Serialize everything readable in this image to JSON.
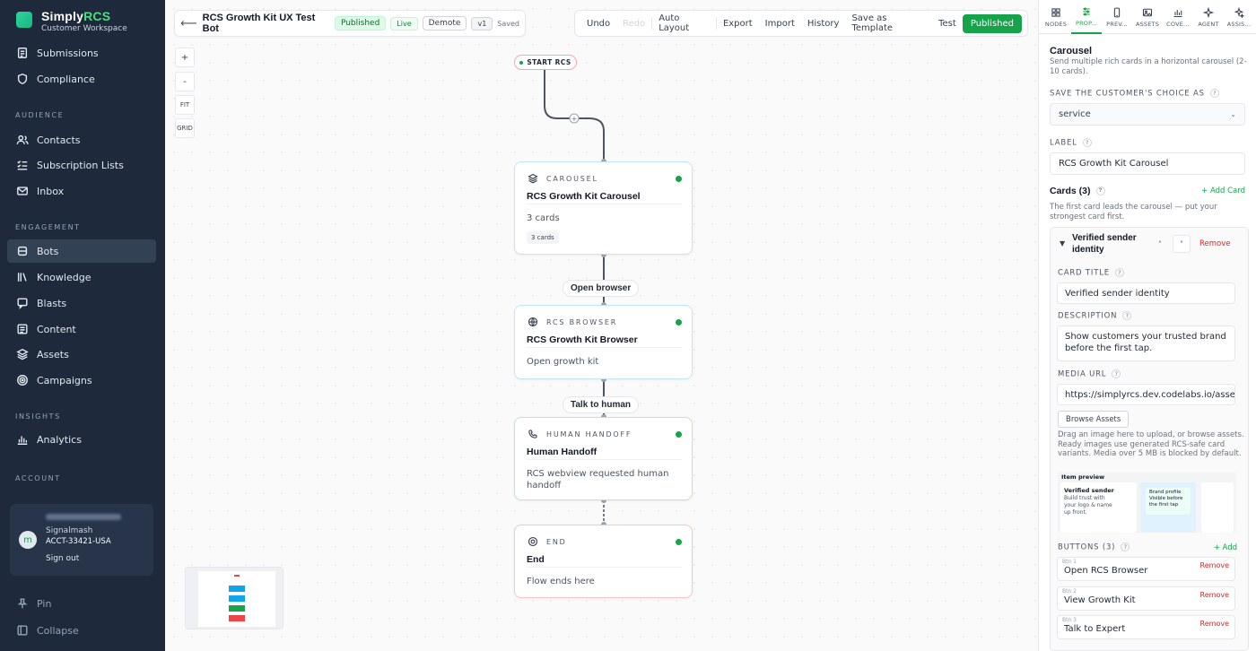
{
  "brand": {
    "name_prefix": "Simply",
    "name_suffix": "RCS",
    "subtitle": "Customer Workspace"
  },
  "sidebar": {
    "sections": {
      "audience": "AUDIENCE",
      "engagement": "ENGAGEMENT",
      "insights": "INSIGHTS",
      "account": "ACCOUNT"
    },
    "items": {
      "submissions": "Submissions",
      "compliance": "Compliance",
      "contacts": "Contacts",
      "subscription_lists": "Subscription Lists",
      "inbox": "Inbox",
      "bots": "Bots",
      "knowledge": "Knowledge",
      "blasts": "Blasts",
      "content": "Content",
      "assets": "Assets",
      "campaigns": "Campaigns",
      "analytics": "Analytics",
      "pin": "Pin",
      "collapse": "Collapse"
    },
    "active": "bots",
    "account": {
      "avatar_letter": "m",
      "org": "Signalmash",
      "id": "ACCT-33421-USA",
      "sign_out": "Sign out"
    }
  },
  "toolbar": {
    "back": "⟵",
    "bot_title": "RCS Growth Kit UX Test Bot",
    "status": "Published",
    "live": "Live",
    "demote": "Demote",
    "version": "v1",
    "saved": "Saved",
    "actions": {
      "undo": "Undo",
      "redo": "Redo",
      "auto_layout": "Auto Layout",
      "export": "Export",
      "import": "Import",
      "history": "History",
      "save_template": "Save as Template",
      "test": "Test",
      "published": "Published"
    }
  },
  "zoom": {
    "in": "+",
    "out": "-",
    "fit": "FIT",
    "grid": "GRID"
  },
  "flow": {
    "start": "START RCS",
    "nodes": [
      {
        "type": "CAROUSEL",
        "title": "RCS Growth Kit Carousel",
        "desc": "3 cards",
        "badge": "3 cards"
      },
      {
        "type": "RCS BROWSER",
        "title": "RCS Growth Kit Browser",
        "desc": "Open growth kit"
      },
      {
        "type": "HUMAN HANDOFF",
        "title": "Human Handoff",
        "desc": "RCS webview requested human handoff"
      },
      {
        "type": "END",
        "title": "End",
        "desc": "Flow ends here"
      }
    ],
    "edges": {
      "open_browser": "Open browser",
      "talk_to_human": "Talk to human",
      "add": "+"
    }
  },
  "panel": {
    "tabs": [
      "NODES",
      "PROP...",
      "PREV...",
      "ASSETS",
      "COVE...",
      "AGENT",
      "ASSIS..."
    ],
    "active_tab": 1,
    "title": "Carousel",
    "subtitle": "Send multiple rich cards in a horizontal carousel (2-10 cards).",
    "save_choice_label": "SAVE THE CUSTOMER'S CHOICE AS",
    "save_choice_value": "service",
    "label_label": "LABEL",
    "label_value": "RCS Growth Kit Carousel",
    "cards_heading": "Cards (3)",
    "add_card": "+ Add Card",
    "cards_note": "The first card leads the carousel — put your strongest card first.",
    "qmark": "?",
    "card": {
      "name": "Verified sender identity",
      "up": "˄",
      "down": "˅",
      "caret": "▼",
      "remove": "Remove",
      "title_label": "CARD TITLE",
      "title_value": "Verified sender identity",
      "desc_label": "DESCRIPTION",
      "desc_value": "Show customers your trusted brand before the first tap.",
      "media_label": "MEDIA URL",
      "media_value": "https://simplyrcs.dev.codelabs.io/assets",
      "browse": "Browse Assets",
      "drag_note": "Drag an image here to upload, or browse assets. Ready images use generated RCS-safe card variants. Media over 5 MB is blocked by default.",
      "preview": {
        "heading": "Item preview",
        "card_title": "Verified sender",
        "card_text": "Build trust with your logo & name up front.",
        "card2_text": "Brand profile Visible before the first tap"
      },
      "buttons_label": "BUTTONS (3)",
      "buttons_add": "+ Add",
      "buttons": [
        {
          "idx": "Btn 1",
          "label": "Open RCS Browser",
          "remove": "Remove"
        },
        {
          "idx": "Btn 2",
          "label": "View Growth Kit",
          "remove": "Remove"
        },
        {
          "idx": "Btn 3",
          "label": "Talk to Expert",
          "remove": "Remove"
        }
      ]
    }
  },
  "colors": {
    "accent": "#16a34a",
    "sidebar": "#1e293b",
    "danger": "#dc2626"
  }
}
